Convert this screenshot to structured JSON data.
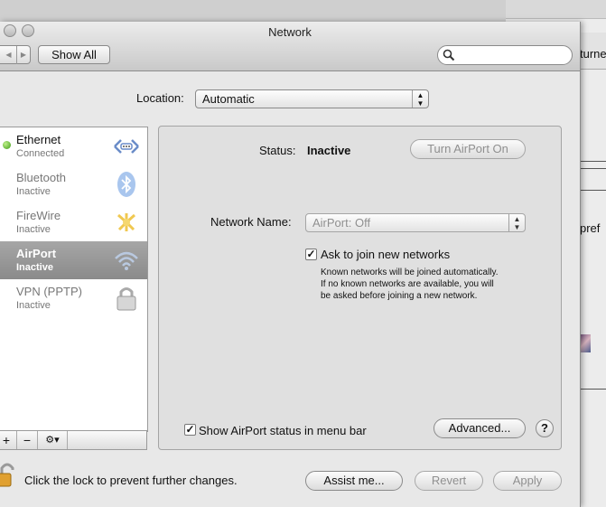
{
  "background_window": {
    "partial_text_1": "turne",
    "partial_text_2": "pref"
  },
  "window": {
    "title": "Network"
  },
  "toolbar": {
    "show_all_label": "Show All",
    "back_glyph": "◀",
    "forward_glyph": "▶",
    "search_placeholder": ""
  },
  "location": {
    "label": "Location:",
    "value": "Automatic"
  },
  "services": [
    {
      "name": "Ethernet",
      "status": "Connected",
      "icon": "ethernet-icon",
      "connected": true
    },
    {
      "name": "Bluetooth",
      "status": "Inactive",
      "icon": "bluetooth-icon"
    },
    {
      "name": "FireWire",
      "status": "Inactive",
      "icon": "firewire-icon"
    },
    {
      "name": "AirPort",
      "status": "Inactive",
      "icon": "wifi-icon",
      "selected": true
    },
    {
      "name": "VPN (PPTP)",
      "status": "Inactive",
      "icon": "vpn-lock-icon"
    }
  ],
  "sidebar_footer": {
    "add": "+",
    "remove": "−",
    "action": "⚙▾"
  },
  "detail": {
    "status_label": "Status:",
    "status_value": "Inactive",
    "turn_on_label": "Turn AirPort On",
    "network_name_label": "Network Name:",
    "network_name_value": "AirPort: Off",
    "ask_join_label": "Ask to join new networks",
    "ask_join_help": [
      "Known networks will be joined automatically.",
      "If no known networks are available, you will",
      "be asked before joining a new network."
    ],
    "show_status_label": "Show AirPort status in menu bar",
    "advanced_label": "Advanced...",
    "help_label": "?"
  },
  "footer": {
    "lock_text": "Click the lock to prevent further changes.",
    "assist_label": "Assist me...",
    "revert_label": "Revert",
    "apply_label": "Apply"
  },
  "colors": {
    "accent_selected": "#8e8e8e",
    "connected_dot": "#3c9a16"
  }
}
